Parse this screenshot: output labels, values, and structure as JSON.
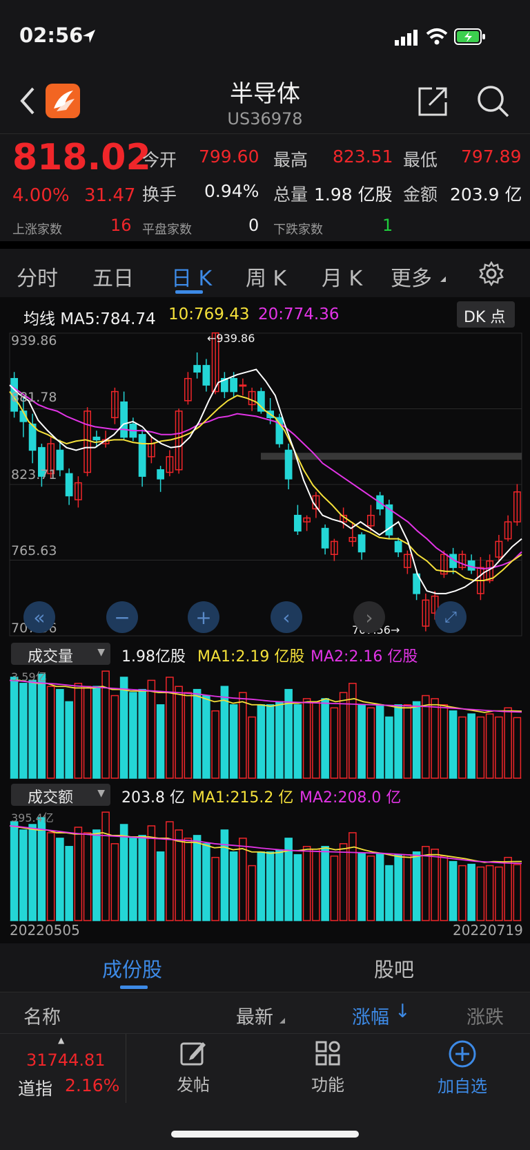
{
  "status": {
    "time": "02:56"
  },
  "header": {
    "title": "半导体",
    "code": "US36978"
  },
  "quote": {
    "price": "818.02",
    "change_pct": "4.00%",
    "change_amt": "31.47",
    "open_label": "今开",
    "open": "799.60",
    "high_label": "最高",
    "high": "823.51",
    "low_label": "最低",
    "low": "797.89",
    "turnover_label": "换手",
    "turnover": "0.94%",
    "volume_label": "总量",
    "volume": "1.98 亿股",
    "amount_label": "金额",
    "amount": "203.9 亿",
    "up_label": "上涨家数",
    "up": "16",
    "flat_label": "平盘家数",
    "flat": "0",
    "down_label": "下跌家数",
    "down": "1"
  },
  "tabs": [
    "分时",
    "五日",
    "日 K",
    "周 K",
    "月 K",
    "更多"
  ],
  "selected_tab": 2,
  "ma_legend": {
    "prefix": "均线 MA5:784.74",
    "ma10": "10:769.43",
    "ma20": "20:774.36",
    "dk_button": "DK 点"
  },
  "colors": {
    "up": "#f0262a",
    "down": "#24d6d6",
    "ma5": "#ffffff",
    "ma10": "#f5e13a",
    "ma20": "#e234e6",
    "accent": "#3d8ae6"
  },
  "price_axis": {
    "labels": [
      "939.86",
      "881.78",
      "823.71",
      "765.63",
      "707.56"
    ],
    "max_marker": "939.86",
    "min_marker": "707.56"
  },
  "volume_panel": {
    "selector": "成交量",
    "value": "1.98亿股",
    "ma1": "MA1:2.19 亿股",
    "ma2": "MA2:2.16 亿股",
    "axis_top": "3.59亿"
  },
  "amount_panel": {
    "selector": "成交额",
    "value": "203.8 亿",
    "ma1": "MA1:215.2 亿",
    "ma2": "MA2:208.0 亿",
    "axis_top": "395.4亿"
  },
  "date_axis": {
    "start": "20220505",
    "end": "20220719"
  },
  "bottom_tabs": {
    "left": "成份股",
    "right": "股吧"
  },
  "list_header": {
    "name": "名称",
    "latest": "最新",
    "change_pct": "涨幅",
    "change": "涨跌"
  },
  "dock": {
    "index_value": "31744.81",
    "index_name": "道指",
    "index_pct": "2.16%",
    "post": "发帖",
    "func": "功能",
    "add": "加自选"
  },
  "chart_data": {
    "type": "candlestick",
    "ylim": [
      707.56,
      939.86
    ],
    "candles": [
      {
        "o": 905,
        "c": 880,
        "h": 910,
        "l": 875
      },
      {
        "o": 880,
        "c": 872,
        "h": 890,
        "l": 860
      },
      {
        "o": 870,
        "c": 850,
        "h": 878,
        "l": 840
      },
      {
        "o": 852,
        "c": 830,
        "h": 855,
        "l": 822
      },
      {
        "o": 832,
        "c": 855,
        "h": 860,
        "l": 828
      },
      {
        "o": 850,
        "c": 835,
        "h": 858,
        "l": 830
      },
      {
        "o": 832,
        "c": 815,
        "h": 836,
        "l": 808
      },
      {
        "o": 812,
        "c": 825,
        "h": 830,
        "l": 806
      },
      {
        "o": 833,
        "c": 880,
        "h": 883,
        "l": 830
      },
      {
        "o": 860,
        "c": 858,
        "h": 865,
        "l": 852
      },
      {
        "o": 855,
        "c": 858,
        "h": 865,
        "l": 852
      },
      {
        "o": 875,
        "c": 895,
        "h": 898,
        "l": 870
      },
      {
        "o": 887,
        "c": 860,
        "h": 895,
        "l": 858
      },
      {
        "o": 870,
        "c": 860,
        "h": 875,
        "l": 857
      },
      {
        "o": 862,
        "c": 830,
        "h": 866,
        "l": 822
      },
      {
        "o": 845,
        "c": 855,
        "h": 860,
        "l": 840
      },
      {
        "o": 835,
        "c": 828,
        "h": 838,
        "l": 818
      },
      {
        "o": 833,
        "c": 845,
        "h": 850,
        "l": 830
      },
      {
        "o": 835,
        "c": 880,
        "h": 882,
        "l": 832
      },
      {
        "o": 888,
        "c": 905,
        "h": 910,
        "l": 885
      },
      {
        "o": 915,
        "c": 910,
        "h": 925,
        "l": 905
      },
      {
        "o": 915,
        "c": 900,
        "h": 920,
        "l": 895
      },
      {
        "o": 895,
        "c": 940,
        "h": 940,
        "l": 893
      },
      {
        "o": 905,
        "c": 895,
        "h": 910,
        "l": 890
      },
      {
        "o": 905,
        "c": 895,
        "h": 910,
        "l": 890
      },
      {
        "o": 900,
        "c": 900,
        "h": 905,
        "l": 892
      },
      {
        "o": 885,
        "c": 895,
        "h": 898,
        "l": 880
      },
      {
        "o": 895,
        "c": 880,
        "h": 898,
        "l": 878
      },
      {
        "o": 880,
        "c": 875,
        "h": 890,
        "l": 870
      },
      {
        "o": 875,
        "c": 855,
        "h": 878,
        "l": 852
      },
      {
        "o": 850,
        "c": 828,
        "h": 855,
        "l": 820
      },
      {
        "o": 800,
        "c": 788,
        "h": 808,
        "l": 785
      },
      {
        "o": 795,
        "c": 798,
        "h": 800,
        "l": 788
      },
      {
        "o": 805,
        "c": 815,
        "h": 818,
        "l": 798
      },
      {
        "o": 790,
        "c": 775,
        "h": 793,
        "l": 770
      },
      {
        "o": 770,
        "c": 780,
        "h": 782,
        "l": 765
      },
      {
        "o": 795,
        "c": 800,
        "h": 806,
        "l": 790
      },
      {
        "o": 780,
        "c": 783,
        "h": 795,
        "l": 776
      },
      {
        "o": 785,
        "c": 772,
        "h": 787,
        "l": 766
      },
      {
        "o": 792,
        "c": 800,
        "h": 808,
        "l": 788
      },
      {
        "o": 815,
        "c": 805,
        "h": 818,
        "l": 800
      },
      {
        "o": 808,
        "c": 785,
        "h": 812,
        "l": 782
      },
      {
        "o": 780,
        "c": 772,
        "h": 783,
        "l": 768
      },
      {
        "o": 760,
        "c": 770,
        "h": 773,
        "l": 755
      },
      {
        "o": 755,
        "c": 740,
        "h": 758,
        "l": 735
      },
      {
        "o": 715,
        "c": 735,
        "h": 740,
        "l": 711
      },
      {
        "o": 725,
        "c": 738,
        "h": 742,
        "l": 720
      },
      {
        "o": 755,
        "c": 770,
        "h": 773,
        "l": 752
      },
      {
        "o": 770,
        "c": 760,
        "h": 775,
        "l": 755
      },
      {
        "o": 760,
        "c": 770,
        "h": 773,
        "l": 758
      },
      {
        "o": 765,
        "c": 758,
        "h": 770,
        "l": 755
      },
      {
        "o": 740,
        "c": 760,
        "h": 768,
        "l": 735
      },
      {
        "o": 750,
        "c": 765,
        "h": 770,
        "l": 748
      },
      {
        "o": 768,
        "c": 780,
        "h": 785,
        "l": 765
      },
      {
        "o": 782,
        "c": 795,
        "h": 800,
        "l": 780
      },
      {
        "o": 795,
        "c": 818,
        "h": 824,
        "l": 792
      }
    ],
    "ma5": [
      900,
      893,
      888,
      873,
      865,
      858,
      852,
      850,
      852,
      852,
      857,
      862,
      870,
      872,
      868,
      860,
      855,
      852,
      853,
      860,
      872,
      888,
      902,
      905,
      908,
      910,
      912,
      903,
      892,
      870,
      850,
      827,
      810,
      800,
      797,
      795,
      790,
      795,
      790,
      785,
      790,
      795,
      780,
      755,
      742,
      740,
      740,
      742,
      745,
      750,
      756,
      760,
      768,
      776,
      782
    ],
    "ma10": [
      895,
      885,
      872,
      865,
      862,
      858,
      855,
      857,
      858,
      856,
      857,
      858,
      858,
      856,
      855,
      855,
      857,
      858,
      860,
      863,
      868,
      875,
      882,
      888,
      892,
      890,
      887,
      880,
      875,
      865,
      850,
      835,
      823,
      815,
      808,
      800,
      795,
      790,
      787,
      783,
      782,
      782,
      778,
      770,
      765,
      758,
      757,
      757,
      752,
      750,
      750,
      752,
      758,
      765,
      770
    ],
    "ma20": [
      900,
      895,
      890,
      885,
      882,
      880,
      876,
      873,
      870,
      868,
      867,
      866,
      866,
      865,
      865,
      864,
      862,
      862,
      863,
      866,
      870,
      872,
      875,
      876,
      878,
      877,
      876,
      874,
      872,
      868,
      862,
      855,
      848,
      840,
      835,
      830,
      825,
      820,
      815,
      810,
      805,
      800,
      795,
      788,
      782,
      775,
      770,
      765,
      762,
      760,
      759,
      760,
      762,
      765,
      772
    ],
    "volume_axis_top": "3.59亿",
    "amount_axis_top": "395.4亿",
    "volume": [
      3.3,
      3.1,
      3.2,
      3.4,
      3.0,
      2.9,
      2.5,
      3.1,
      3.0,
      3.0,
      3.5,
      2.7,
      3.3,
      2.8,
      2.9,
      3.2,
      2.4,
      3.3,
      3.0,
      2.8,
      2.9,
      2.7,
      2.2,
      3.0,
      2.4,
      2.8,
      2.0,
      2.4,
      2.4,
      2.5,
      2.9,
      2.4,
      2.6,
      2.5,
      2.6,
      2.3,
      2.8,
      3.1,
      2.4,
      2.3,
      2.4,
      2.0,
      2.4,
      2.4,
      2.5,
      2.7,
      2.6,
      2.4,
      2.2,
      2.0,
      2.1,
      2.0,
      2.1,
      2.0,
      2.3,
      1.98
    ],
    "volume_ma1": [
      3.2,
      3.2,
      3.15,
      3.1,
      3.1,
      3.0,
      3.0,
      2.95,
      2.95,
      2.95,
      3.0,
      2.9,
      2.9,
      2.85,
      2.85,
      2.85,
      2.8,
      2.8,
      2.75,
      2.7,
      2.7,
      2.6,
      2.5,
      2.55,
      2.45,
      2.5,
      2.4,
      2.4,
      2.35,
      2.4,
      2.45,
      2.45,
      2.5,
      2.5,
      2.6,
      2.5,
      2.55,
      2.6,
      2.5,
      2.45,
      2.4,
      2.35,
      2.3,
      2.3,
      2.35,
      2.4,
      2.4,
      2.35,
      2.3,
      2.25,
      2.2,
      2.15,
      2.2,
      2.2,
      2.2,
      2.19
    ],
    "volume_ma2": [
      3.2,
      3.18,
      3.15,
      3.12,
      3.1,
      3.08,
      3.05,
      3.02,
      3.0,
      2.98,
      2.96,
      2.94,
      2.92,
      2.9,
      2.88,
      2.86,
      2.84,
      2.82,
      2.8,
      2.78,
      2.76,
      2.72,
      2.68,
      2.65,
      2.62,
      2.6,
      2.58,
      2.55,
      2.52,
      2.5,
      2.49,
      2.48,
      2.47,
      2.46,
      2.45,
      2.44,
      2.43,
      2.42,
      2.41,
      2.4,
      2.39,
      2.38,
      2.37,
      2.36,
      2.35,
      2.34,
      2.32,
      2.3,
      2.28,
      2.26,
      2.24,
      2.22,
      2.2,
      2.18,
      2.17,
      2.16
    ],
    "amount": [
      360,
      330,
      350,
      375,
      320,
      300,
      270,
      340,
      320,
      330,
      395,
      280,
      350,
      300,
      310,
      345,
      250,
      360,
      330,
      300,
      310,
      280,
      230,
      330,
      250,
      300,
      200,
      250,
      250,
      255,
      300,
      240,
      270,
      260,
      270,
      235,
      280,
      320,
      245,
      235,
      245,
      200,
      240,
      240,
      250,
      270,
      260,
      235,
      215,
      200,
      205,
      195,
      200,
      195,
      230,
      204
    ],
    "amount_ma1": [
      345,
      340,
      335,
      330,
      330,
      320,
      320,
      315,
      315,
      315,
      320,
      310,
      310,
      305,
      305,
      305,
      300,
      300,
      290,
      285,
      285,
      275,
      265,
      268,
      258,
      262,
      250,
      250,
      245,
      248,
      255,
      255,
      260,
      260,
      265,
      258,
      262,
      268,
      258,
      250,
      245,
      238,
      232,
      230,
      235,
      240,
      240,
      235,
      230,
      225,
      218,
      212,
      215,
      214,
      215,
      215.2
    ],
    "amount_ma2": [
      345,
      342,
      338,
      334,
      330,
      326,
      322,
      318,
      315,
      312,
      310,
      308,
      306,
      304,
      302,
      300,
      298,
      296,
      294,
      292,
      290,
      285,
      280,
      277,
      274,
      271,
      268,
      264,
      261,
      258,
      256,
      254,
      253,
      252,
      251,
      250,
      249,
      248,
      247,
      246,
      245,
      243,
      241,
      239,
      237,
      235,
      232,
      228,
      224,
      220,
      216,
      214,
      212,
      210,
      209,
      208
    ]
  }
}
